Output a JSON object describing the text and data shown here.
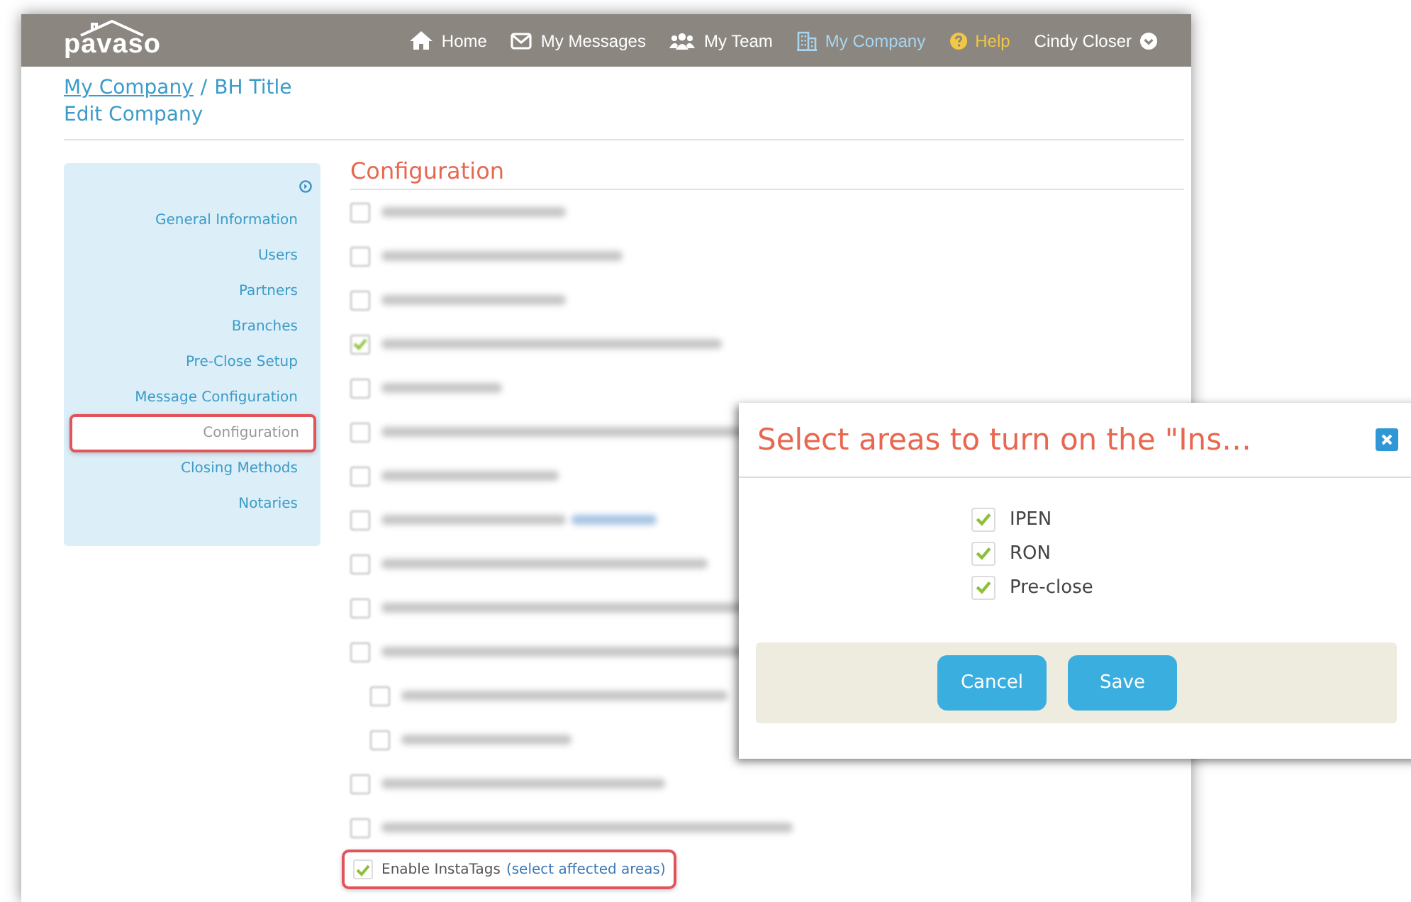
{
  "nav": {
    "logo": "pavaso",
    "items": [
      {
        "label": "Home",
        "kind": "link",
        "selected": false
      },
      {
        "label": "My Messages",
        "kind": "link",
        "selected": false
      },
      {
        "label": "My Team",
        "kind": "link",
        "selected": false
      },
      {
        "label": "My Company",
        "kind": "link",
        "selected": true
      },
      {
        "label": "Help",
        "kind": "help",
        "selected": false
      },
      {
        "label": "Cindy Closer",
        "kind": "user",
        "selected": false
      }
    ]
  },
  "breadcrumb": {
    "link": "My Company",
    "separator": "/",
    "current": "BH Title"
  },
  "page_title": "Edit Company",
  "sidebar": {
    "items": [
      {
        "label": "General Information",
        "selected": false
      },
      {
        "label": "Users",
        "selected": false
      },
      {
        "label": "Partners",
        "selected": false
      },
      {
        "label": "Branches",
        "selected": false
      },
      {
        "label": "Pre-Close Setup",
        "selected": false
      },
      {
        "label": "Message Configuration",
        "selected": false
      },
      {
        "label": "Configuration",
        "selected": true
      },
      {
        "label": "Closing Methods",
        "selected": false
      },
      {
        "label": "Notaries",
        "selected": false
      }
    ]
  },
  "section_title": "Configuration",
  "settings": [
    {
      "kind": "blurred",
      "checked": false
    },
    {
      "kind": "blurred",
      "checked": false
    },
    {
      "kind": "blurred",
      "checked": false
    },
    {
      "kind": "blurred",
      "checked": true
    },
    {
      "kind": "blurred",
      "checked": false
    },
    {
      "kind": "blurred",
      "checked": false
    },
    {
      "kind": "blurred",
      "checked": false
    },
    {
      "kind": "blurred",
      "checked": false,
      "link": true
    },
    {
      "kind": "blurred",
      "checked": false
    },
    {
      "kind": "blurred",
      "checked": false
    },
    {
      "kind": "blurred",
      "checked": false,
      "children": [
        {
          "kind": "blurred",
          "checked": false
        },
        {
          "kind": "blurred",
          "checked": false
        }
      ]
    },
    {
      "kind": "blurred",
      "checked": false
    },
    {
      "kind": "blurred",
      "checked": false
    },
    {
      "kind": "text",
      "checked": true,
      "highlighted": true,
      "label": "Enable InstaTags",
      "link_text": "(select affected areas)"
    }
  ],
  "dialog": {
    "title": "Select areas to turn on the \"Ins…",
    "options": [
      {
        "label": "IPEN",
        "checked": true
      },
      {
        "label": "RON",
        "checked": true
      },
      {
        "label": "Pre-close",
        "checked": true
      }
    ],
    "buttons": [
      "Cancel",
      "Save"
    ]
  }
}
